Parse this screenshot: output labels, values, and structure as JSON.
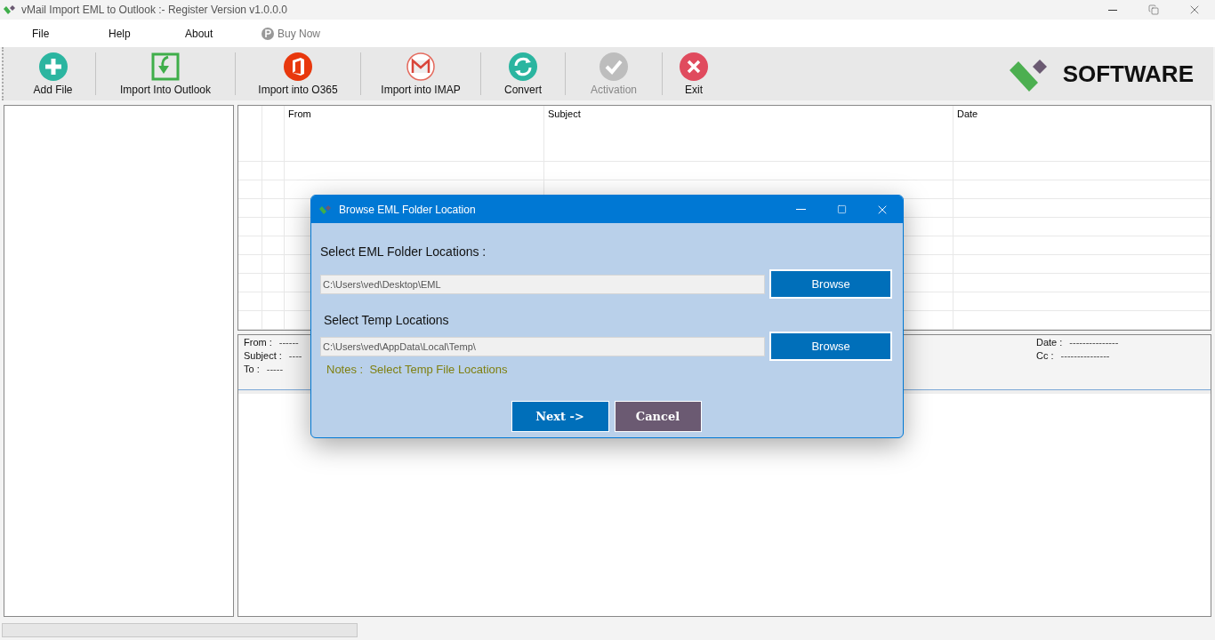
{
  "window": {
    "title": "vMail Import EML to Outlook  :- Register Version v1.0.0.0"
  },
  "menu": [
    {
      "label": "File",
      "kind": "text"
    },
    {
      "label": "Help",
      "kind": "text"
    },
    {
      "label": "About",
      "kind": "text"
    },
    {
      "label": "Buy Now",
      "kind": "buy"
    }
  ],
  "toolbar": [
    {
      "label": "Add File",
      "kind": "add",
      "disabled": false
    },
    {
      "label": "Import Into Outlook",
      "kind": "outlook",
      "disabled": false
    },
    {
      "label": "Import into O365",
      "kind": "office",
      "disabled": false
    },
    {
      "label": "Import into IMAP",
      "kind": "mail",
      "disabled": false
    },
    {
      "label": "Convert",
      "kind": "convert",
      "disabled": false
    },
    {
      "label": "Activation",
      "kind": "check",
      "disabled": true
    },
    {
      "label": "Exit",
      "kind": "exit",
      "disabled": false
    }
  ],
  "logo": {
    "text": "SOFTWARE"
  },
  "table": {
    "columns": [
      "From",
      "Subject",
      "Date"
    ]
  },
  "preview": {
    "left": [
      {
        "label": "From :",
        "value": "------"
      },
      {
        "label": "Subject :",
        "value": "----"
      },
      {
        "label": "To :",
        "value": "-----"
      }
    ],
    "right": [
      {
        "label": "Date :",
        "value": "---------------"
      },
      {
        "label": "Cc :",
        "value": "---------------"
      }
    ]
  },
  "dialog": {
    "title": "Browse EML Folder Location",
    "eml_label": "Select EML Folder Locations :",
    "eml_path": "C:\\Users\\ved\\Desktop\\EML",
    "eml_button": "Browse",
    "temp_label": "Select Temp Locations",
    "temp_path": "C:\\Users\\ved\\AppData\\Local\\Temp\\",
    "temp_button": "Browse",
    "notes_label": "Notes :",
    "notes_text": "Select Temp File Locations",
    "next": "Next  ->",
    "cancel": "Cancel"
  }
}
